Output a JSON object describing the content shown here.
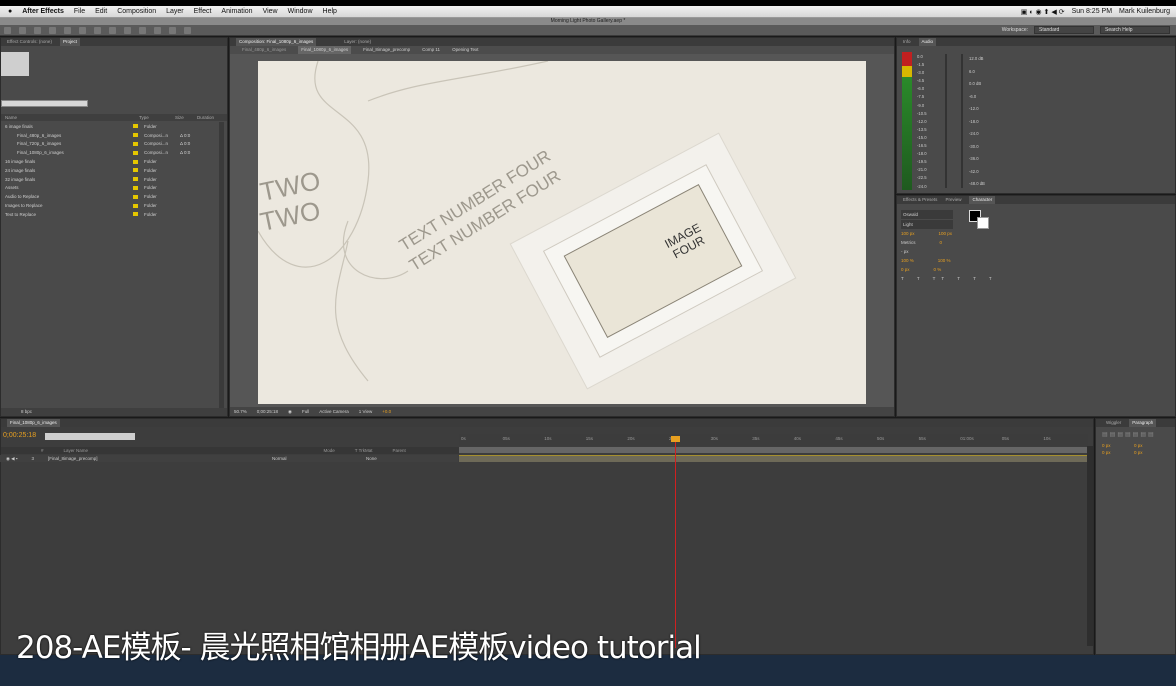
{
  "menubar": {
    "app": "After Effects",
    "items": [
      "File",
      "Edit",
      "Composition",
      "Layer",
      "Effect",
      "Animation",
      "View",
      "Window",
      "Help"
    ],
    "clock": "Sun 8:25 PM",
    "user": "Mark Kuilenburg"
  },
  "window_title": "Morning Light Photo Gallery.aep *",
  "toolbar": {
    "workspace_label": "Workspace:",
    "workspace_value": "Standard",
    "search": "Search Help"
  },
  "project_panel": {
    "tabs": [
      "Effect Controls: (none)",
      "Project"
    ],
    "columns": [
      "Name",
      "Type",
      "Size",
      "Duration"
    ],
    "rows": [
      {
        "name": "6 image finals",
        "type": "Folder",
        "dur": ""
      },
      {
        "name": "Final_480p_6_images",
        "type": "Composi...n",
        "dur": "Δ 0:0"
      },
      {
        "name": "Final_720p_6_images",
        "type": "Composi...n",
        "dur": "Δ 0:0"
      },
      {
        "name": "Final_1080p_6_images",
        "type": "Composi...n",
        "dur": "Δ 0:0"
      },
      {
        "name": "16 image finals",
        "type": "Folder",
        "dur": ""
      },
      {
        "name": "24 image finals",
        "type": "Folder",
        "dur": ""
      },
      {
        "name": "32 image finals",
        "type": "Folder",
        "dur": ""
      },
      {
        "name": "Assets",
        "type": "Folder",
        "dur": ""
      },
      {
        "name": "Audio to Replace",
        "type": "Folder",
        "dur": ""
      },
      {
        "name": "Images to Replace",
        "type": "Folder",
        "dur": ""
      },
      {
        "name": "Text to Replace",
        "type": "Folder",
        "dur": ""
      }
    ],
    "bpc": "8 bpc"
  },
  "comp_panel": {
    "header": "Composition: Final_1080p_6_images",
    "layer_tab": "Layer: (none)",
    "breadcrumbs": [
      "Final_480p_6_images",
      "Final_1080p_6_images",
      "Final_8image_precomp",
      "Comp 11",
      "Opening Text"
    ],
    "canvas_text": {
      "two_a": "TWO",
      "two_b": "TWO",
      "num_a": "TEXT NUMBER FOUR",
      "num_b": "TEXT NUMBER FOUR",
      "image_label": "IMAGE FOUR"
    },
    "zoom": "50.7%",
    "timecode": "0;00:25:18",
    "resolution": "Full",
    "camera": "Active Camera",
    "views": "1 View",
    "exposure": "+0.0"
  },
  "info_panel": {
    "tabs": [
      "Info",
      "Audio"
    ],
    "left_scale": [
      "0.0",
      "-1.5",
      "-3.0",
      "-4.5",
      "-6.0",
      "-7.5",
      "-9.0",
      "-10.5",
      "-12.0",
      "-13.5",
      "-15.0",
      "-16.5",
      "-18.0",
      "-19.5",
      "-21.0",
      "-22.5",
      "-24.0"
    ],
    "right_scale": [
      "12.0 dB",
      "6.0",
      "0.0 dB",
      "-6.0",
      "-12.0",
      "-18.0",
      "-24.0",
      "-30.0",
      "-36.0",
      "-42.0",
      "-48.0 dB"
    ]
  },
  "character_panel": {
    "tabs": [
      "Effects & Presets",
      "Preview",
      "Character"
    ],
    "font": "Oswald",
    "style": "Light",
    "size": "100 px",
    "leading": "100 px",
    "tracking": "Metrics",
    "tracking_val": "0",
    "stroke": "- px",
    "scale_v": "100 %",
    "scale_h": "100 %",
    "baseline": "0 px",
    "tsume": "0 %"
  },
  "timeline": {
    "tab": "Final_1080p_6_images",
    "timecode": "0;00:25:18",
    "columns": [
      "#",
      "Layer Name",
      "Mode",
      "T TrkMat",
      "Parent"
    ],
    "layer": {
      "num": "3",
      "name": "[Final_8image_precomp]",
      "mode": "Normal",
      "parent": "None"
    },
    "ruler": [
      "0s",
      "05s",
      "10s",
      "15s",
      "20s",
      "25s",
      "30s",
      "35s",
      "40s",
      "45s",
      "50s",
      "55s",
      "01:00s",
      "05s",
      "10s"
    ]
  },
  "right_bottom_panel": {
    "tabs": [
      "Wiggler",
      "Paragraph"
    ],
    "values": [
      "0 px",
      "0 px",
      "0 px",
      "0 px"
    ]
  },
  "caption": "208-AE模板- 晨光照相馆相册AE模板video tutorial",
  "colors": {
    "accent_orange": "#e8a020",
    "label_yellow": "#e5c700",
    "playhead": "#d02020"
  }
}
